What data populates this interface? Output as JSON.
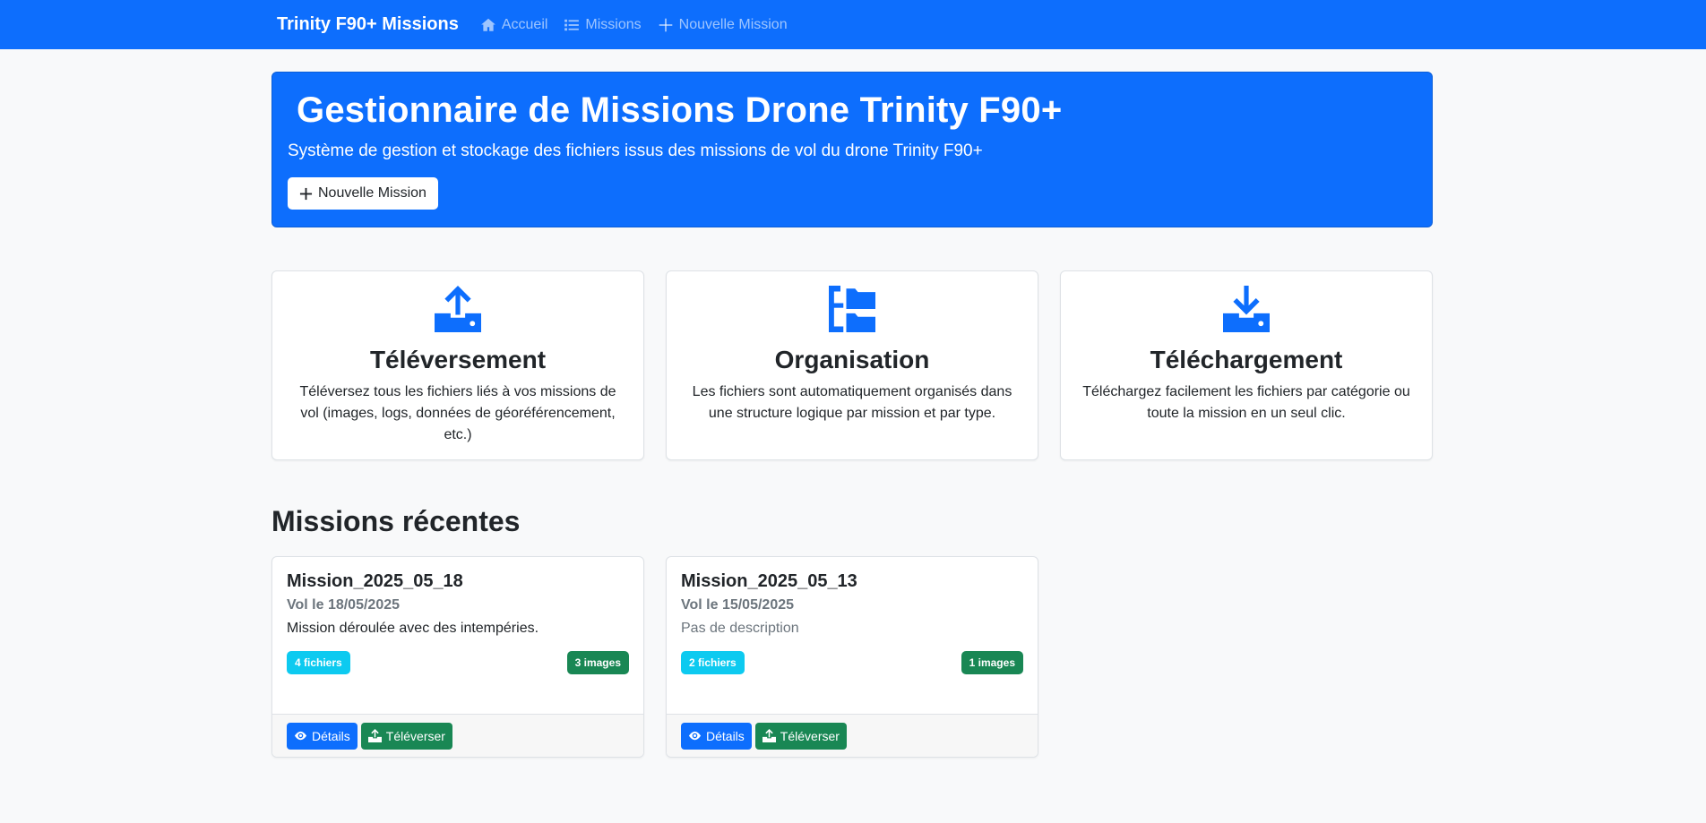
{
  "navbar": {
    "brand": "Trinity F90+ Missions",
    "links": [
      {
        "label": "Accueil",
        "icon": "home-icon"
      },
      {
        "label": "Missions",
        "icon": "list-icon"
      },
      {
        "label": "Nouvelle Mission",
        "icon": "plus-icon"
      }
    ]
  },
  "hero": {
    "title": "Gestionnaire de Missions Drone Trinity F90+",
    "subtitle": "Système de gestion et stockage des fichiers issus des missions de vol du drone Trinity F90+",
    "button_label": "Nouvelle Mission"
  },
  "features": [
    {
      "title": "Téléversement",
      "text": "Téléversez tous les fichiers liés à vos missions de vol (images, logs, données de géoréférencement, etc.)",
      "icon": "upload-icon"
    },
    {
      "title": "Organisation",
      "text": "Les fichiers sont automatiquement organisés dans une structure logique par mission et par type.",
      "icon": "folder-tree-icon"
    },
    {
      "title": "Téléchargement",
      "text": "Téléchargez facilement les fichiers par catégorie ou toute la mission en un seul clic.",
      "icon": "download-icon"
    }
  ],
  "recent": {
    "title": "Missions récentes",
    "missions": [
      {
        "name": "Mission_2025_05_18",
        "date": "Vol le 18/05/2025",
        "description": "Mission déroulée avec des intempéries.",
        "files": "4 fichiers",
        "images": "3 images",
        "details_label": "Détails",
        "upload_label": "Téléverser"
      },
      {
        "name": "Mission_2025_05_13",
        "date": "Vol le 15/05/2025",
        "description": "Pas de description",
        "files": "2 fichiers",
        "images": "1 images",
        "details_label": "Détails",
        "upload_label": "Téléverser"
      }
    ]
  },
  "colors": {
    "primary": "#0d6efd",
    "success": "#198754",
    "info": "#0dcaf0"
  }
}
